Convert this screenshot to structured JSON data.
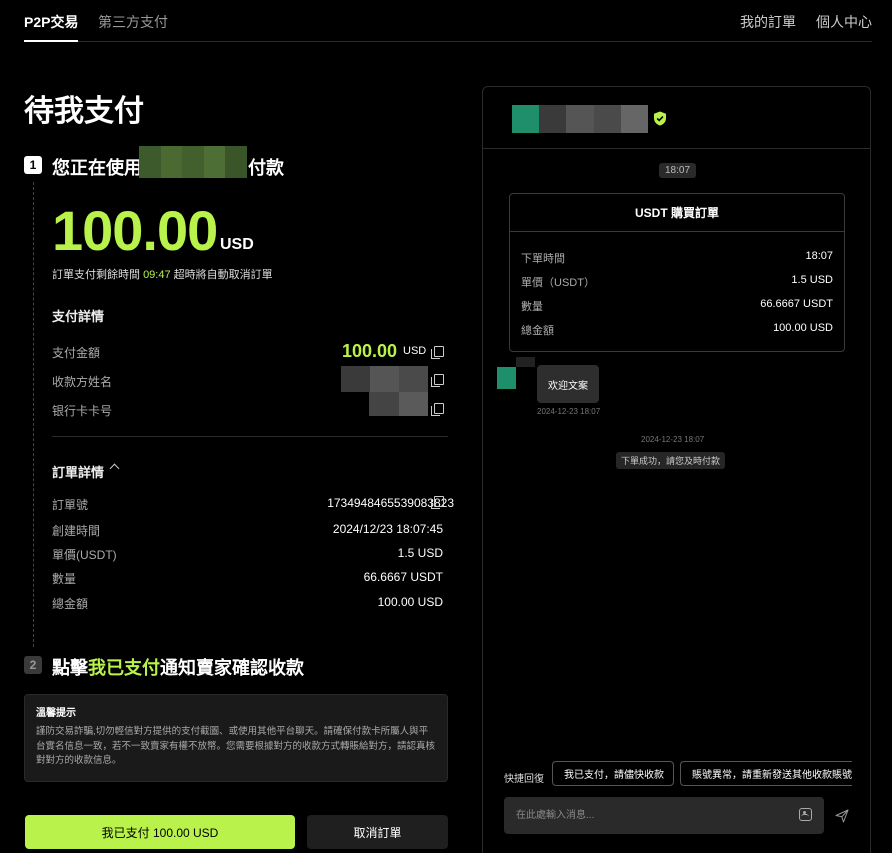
{
  "nav": {
    "tabs": [
      "P2P交易",
      "第三方支付"
    ],
    "right": [
      "我的訂單",
      "個人中心"
    ]
  },
  "page": {
    "title": "待我支付",
    "step1": {
      "num": "1",
      "prefix": "您正在使用",
      "suffix": "付款"
    },
    "step2": {
      "num": "2",
      "prefix": "點擊",
      "highlight": "我已支付",
      "suffix": "通知賣家確認收款"
    }
  },
  "amount": {
    "value": "100.00",
    "currency": "USD"
  },
  "countdown": {
    "prefix": "訂單支付剩餘時間",
    "time": "09:47",
    "suffix": "超時將自動取消訂單"
  },
  "pay_details": {
    "title": "支付詳情",
    "rows": [
      {
        "label": "支付金額",
        "value": "100.00",
        "currency": "USD"
      },
      {
        "label": "收款方姓名"
      },
      {
        "label": "银行卡卡号"
      }
    ]
  },
  "order_details": {
    "title": "訂單詳情",
    "rows": [
      {
        "label": "訂單號",
        "value": "1734948465539083823"
      },
      {
        "label": "創建時間",
        "value": "2024/12/23 18:07:45"
      },
      {
        "label": "單價(USDT)",
        "value": "1.5 USD"
      },
      {
        "label": "數量",
        "value": "66.6667 USDT"
      },
      {
        "label": "總金額",
        "value": "100.00 USD"
      }
    ]
  },
  "notice": {
    "title": "溫馨提示",
    "body": "謹防交易詐騙,切勿輕信對方提供的支付截圖、或使用其他平台聊天。請確保付款卡所屬人與平台實名信息一致，若不一致賣家有權不放幣。您需要根據對方的收款方式轉賬給對方，請認真核對對方的收款信息。"
  },
  "buttons": {
    "paid": "我已支付 100.00 USD",
    "cancel": "取消訂單"
  },
  "chat": {
    "time_pill": "18:07",
    "order_card": {
      "title": "USDT 購買訂單",
      "rows": [
        {
          "label": "下單時間",
          "value": "18:07"
        },
        {
          "label": "單價（USDT）",
          "value": "1.5 USD"
        },
        {
          "label": "數量",
          "value": "66.6667 USDT"
        },
        {
          "label": "總金額",
          "value": "100.00 USD"
        }
      ]
    },
    "message": {
      "text": "欢迎文案",
      "time": "2024-12-23 18:07"
    },
    "system": {
      "time": "2024-12-23 18:07",
      "text": "下單成功，請您及時付款"
    },
    "quick_reply": {
      "label": "快捷回復",
      "options": [
        "我已支付，請儘快收款",
        "賬號異常，請重新發送其他收款賬號"
      ]
    },
    "input_placeholder": "在此處輸入消息..."
  },
  "colors": {
    "accent": "#b8f24a",
    "background": "#000000",
    "verified": "#b8f24a"
  },
  "icons": [
    "copy-icon",
    "chevron-up-icon",
    "verified-shield-icon",
    "image-icon",
    "send-icon"
  ]
}
